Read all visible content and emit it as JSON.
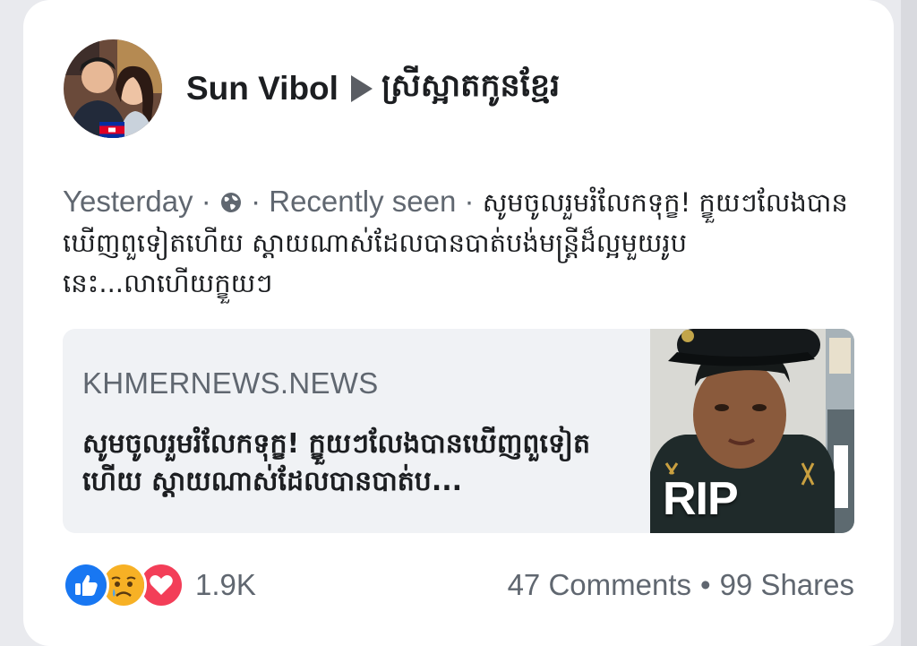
{
  "post": {
    "author": "Sun Vibol",
    "page": "ស្រីស្អាតកូនខ្មែរ",
    "timestamp": "Yesterday",
    "meta_separator": "·",
    "privacy_icon": "globe-icon",
    "seen_status": "· Recently seen ·",
    "text": "សូមចូលរួមរំលែកទុក្ខ! ក្ខួយៗលែងបានឃើញពួទៀតហើយ ស្តាយណាស់ដែលបានបាត់បង់មន្ត្រីដ៏ល្អមួយរូបនេះ...លាហើយក្ខួយៗ"
  },
  "link_preview": {
    "domain": "KHMERNEWS.NEWS",
    "title": "សូមចូលរួមរំលែកទុក្ខ! ក្ខួយៗលែងបានឃើញពួទៀតហើយ ស្តាយណាស់ដែលបានបាត់ប...",
    "image_label": "RIP"
  },
  "reactions": {
    "icons": [
      "like-icon",
      "sad-icon",
      "love-icon"
    ],
    "count": "1.9K"
  },
  "stats": {
    "comments": "47 Comments",
    "separator": "•",
    "shares": "99 Shares"
  },
  "colors": {
    "text_primary": "#1c1e21",
    "text_secondary": "#606770",
    "like_blue": "#1877f2",
    "love_red": "#f33e58",
    "sad_yellow": "#f7b125",
    "card_bg": "#ffffff",
    "preview_bg": "#f0f2f5"
  }
}
